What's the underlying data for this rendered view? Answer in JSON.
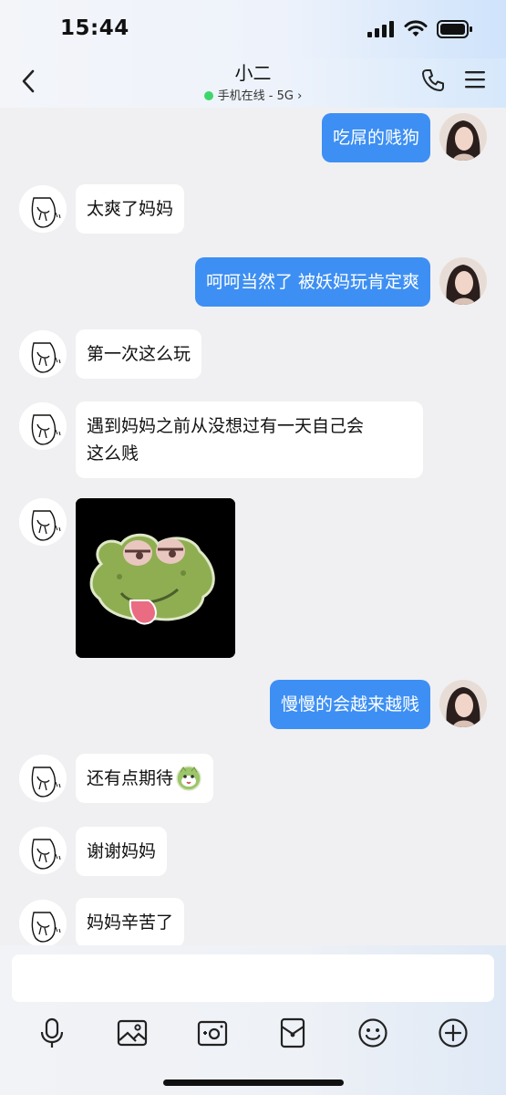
{
  "status_bar": {
    "time": "15:44"
  },
  "header": {
    "back_icon": "chevron-left-icon",
    "title": "小二",
    "subtitle": "手机在线 - 5G",
    "subtitle_chevron": "›",
    "phone_icon": "phone-icon",
    "menu_icon": "menu-icon",
    "online_color": "#3ed66b"
  },
  "colors": {
    "outgoing_bubble": "#3d8ff3",
    "incoming_bubble": "#ffffff",
    "background": "#f0f0f2"
  },
  "messages": [
    {
      "side": "out",
      "text": "吃屌的贱狗"
    },
    {
      "side": "in",
      "text": "太爽了妈妈"
    },
    {
      "side": "out",
      "text": "呵呵当然了 被妖妈玩肯定爽"
    },
    {
      "side": "in",
      "text": "第一次这么玩"
    },
    {
      "side": "in",
      "text": "遇到妈妈之前从没想过有一天自己会\n这么贱"
    },
    {
      "side": "in",
      "sticker": "frog-sticker"
    },
    {
      "side": "out",
      "text": "慢慢的会越来越贱"
    },
    {
      "side": "in",
      "text": "还有点期待"
    },
    {
      "side": "in",
      "text": "谢谢妈妈"
    },
    {
      "side": "in",
      "text": "妈妈辛苦了"
    }
  ],
  "composer": {
    "input_value": "",
    "tools": [
      "microphone-icon",
      "image-icon",
      "camera-icon",
      "red-packet-icon",
      "emoji-icon",
      "plus-icon"
    ]
  }
}
